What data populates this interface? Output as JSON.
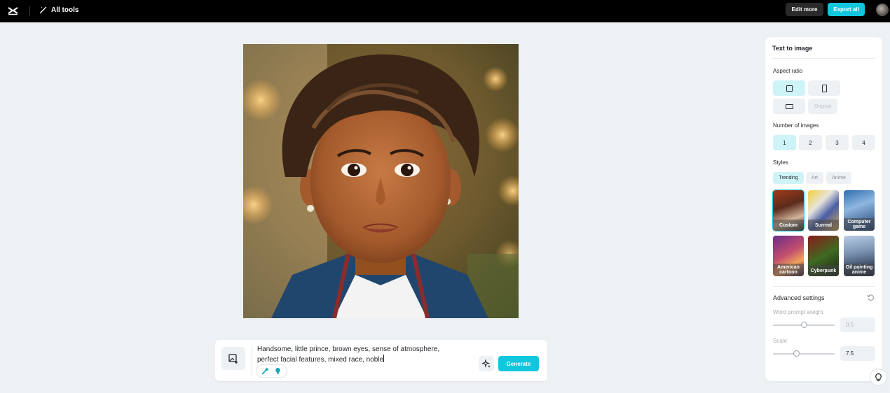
{
  "topbar": {
    "logo_icon": "capcut-logo-icon",
    "all_tools_label": "All tools",
    "edit_more_label": "Edit more",
    "export_all_label": "Export all",
    "accent_color": "#12c6dd"
  },
  "canvas": {
    "image_subject": "generated-portrait-image"
  },
  "prompt": {
    "text": "Handsome, little prince, brown eyes, sense of atmosphere,\nperfect facial features, mixed race, noble",
    "generate_label": "Generate"
  },
  "panel": {
    "title": "Text to image",
    "aspect_ratio_label": "Aspect ratio",
    "aspect_options": [
      {
        "icon": "square-ratio-icon",
        "selected": true
      },
      {
        "icon": "portrait-ratio-icon",
        "selected": false
      },
      {
        "icon": "landscape-ratio-icon",
        "selected": false
      },
      {
        "label": "Original",
        "disabled": true
      }
    ],
    "num_images_label": "Number of images",
    "num_options": [
      "1",
      "2",
      "3",
      "4"
    ],
    "num_selected": "1",
    "styles_label": "Styles",
    "style_tabs": [
      "Trending",
      "Art",
      "Anime"
    ],
    "style_tab_selected": "Trending",
    "styles": [
      {
        "label": "Custom",
        "selected": true
      },
      {
        "label": "Surreal",
        "selected": false
      },
      {
        "label": "Computer game",
        "selected": false
      },
      {
        "label": "American cartoon",
        "selected": false
      },
      {
        "label": "Cyberpunk",
        "selected": false
      },
      {
        "label": "Oil painting anime",
        "selected": false
      }
    ],
    "advanced_label": "Advanced settings",
    "word_weight_label": "Word prompt weight",
    "word_weight_value": "0.5",
    "word_weight_level": 0.5,
    "scale_label": "Scale",
    "scale_value": "7.5",
    "scale_level": 0.375
  }
}
